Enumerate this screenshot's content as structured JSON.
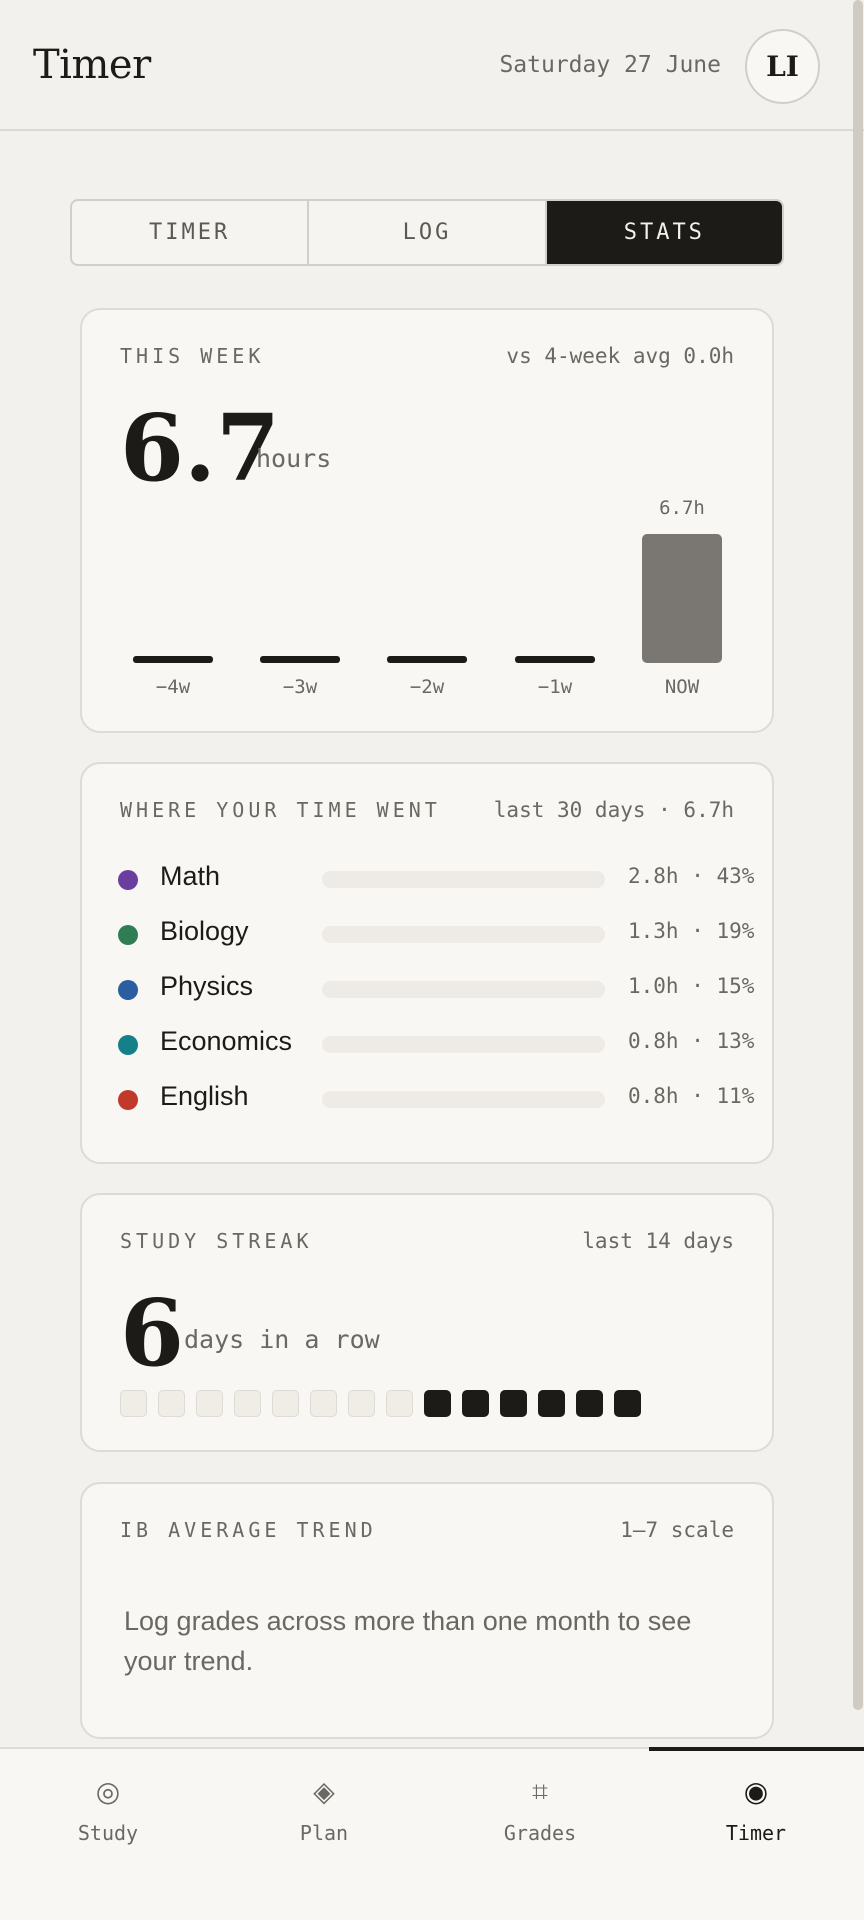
{
  "header": {
    "title": "Timer",
    "date": "Saturday 27 June",
    "avatar_initials": "LI"
  },
  "tabs": [
    {
      "label": "TIMER",
      "active": false
    },
    {
      "label": "LOG",
      "active": false
    },
    {
      "label": "STATS",
      "active": true
    }
  ],
  "week_card": {
    "label": "THIS WEEK",
    "meta": "vs 4-week avg 0.0h",
    "value": "6.7",
    "unit": "hours"
  },
  "chart_data": {
    "type": "bar",
    "categories": [
      "−4w",
      "−3w",
      "−2w",
      "−1w",
      "NOW"
    ],
    "values": [
      0,
      0,
      0,
      0,
      6.7
    ],
    "data_labels": [
      "",
      "",
      "",
      "",
      "6.7h"
    ],
    "highlight_color": "#7a7772",
    "base_color": "#1c1b18",
    "ylim": [
      0,
      6.7
    ],
    "grid": false
  },
  "subjects_card": {
    "label": "WHERE YOUR TIME WENT",
    "meta": "last 30 days · 6.7h",
    "subjects": [
      {
        "name": "Math",
        "value": "2.8h · 43%",
        "fraction": 0.43,
        "color": "#6b3fa0"
      },
      {
        "name": "Biology",
        "value": "1.3h · 19%",
        "fraction": 0.19,
        "color": "#2f7d55"
      },
      {
        "name": "Physics",
        "value": "1.0h · 15%",
        "fraction": 0.15,
        "color": "#2a5ea0"
      },
      {
        "name": "Economics",
        "value": "0.8h · 13%",
        "fraction": 0.13,
        "color": "#15808a"
      },
      {
        "name": "English",
        "value": "0.8h · 11%",
        "fraction": 0.11,
        "color": "#c0392b"
      }
    ]
  },
  "streak_card": {
    "label": "STUDY STREAK",
    "meta": "last 14 days",
    "value": "6",
    "unit": "days in a row",
    "days": [
      false,
      false,
      false,
      false,
      false,
      false,
      false,
      false,
      true,
      true,
      true,
      true,
      true,
      true
    ]
  },
  "trend_card": {
    "label": "IB AVERAGE TREND",
    "meta": "1–7 scale",
    "message": "Log grades across more than one month to see your trend."
  },
  "nav": [
    {
      "icon": "◎",
      "label": "Study",
      "icon_name": "study-icon",
      "active": false
    },
    {
      "icon": "◈",
      "label": "Plan",
      "icon_name": "plan-icon",
      "active": false
    },
    {
      "icon": "⌗",
      "label": "Grades",
      "icon_name": "grades-icon",
      "active": false
    },
    {
      "icon": "◉",
      "label": "Timer",
      "icon_name": "timer-icon",
      "active": true
    }
  ]
}
